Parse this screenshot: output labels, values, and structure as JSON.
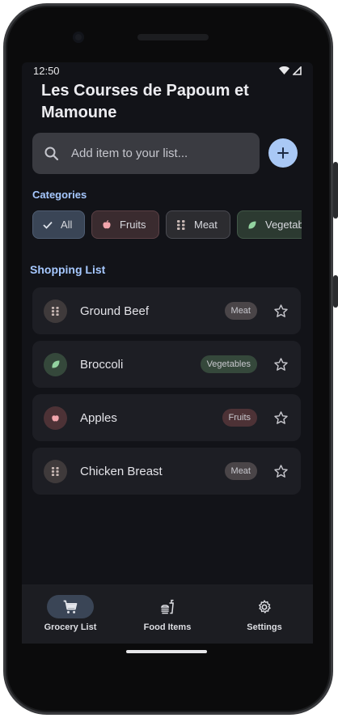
{
  "status_bar": {
    "time": "12:50"
  },
  "app": {
    "title": "Les Courses de Papoum et Mamoune"
  },
  "search": {
    "placeholder": "Add item to your list..."
  },
  "categories": {
    "heading": "Categories",
    "chips": [
      {
        "label": "All",
        "icon": "check-icon",
        "selected": true
      },
      {
        "label": "Fruits",
        "icon": "apple-icon"
      },
      {
        "label": "Meat",
        "icon": "meat-icon"
      },
      {
        "label": "Vegetab",
        "icon": "leaf-icon"
      }
    ]
  },
  "shopping_list": {
    "heading": "Shopping List",
    "items": [
      {
        "name": "Ground Beef",
        "category": "Meat",
        "icon": "meat-icon"
      },
      {
        "name": "Broccoli",
        "category": "Vegetables",
        "icon": "leaf-icon"
      },
      {
        "name": "Apples",
        "category": "Fruits",
        "icon": "apple-icon"
      },
      {
        "name": "Chicken Breast",
        "category": "Meat",
        "icon": "meat-icon"
      }
    ]
  },
  "bottom_nav": [
    {
      "label": "Grocery List",
      "icon": "cart-icon",
      "active": true
    },
    {
      "label": "Food Items",
      "icon": "fastfood-icon"
    },
    {
      "label": "Settings",
      "icon": "gear-icon"
    }
  ],
  "colors": {
    "accent": "#a6c8ff",
    "meat_badge": "#4a4548",
    "vegetables_badge": "#35483b",
    "fruits_badge": "#4d3236"
  }
}
